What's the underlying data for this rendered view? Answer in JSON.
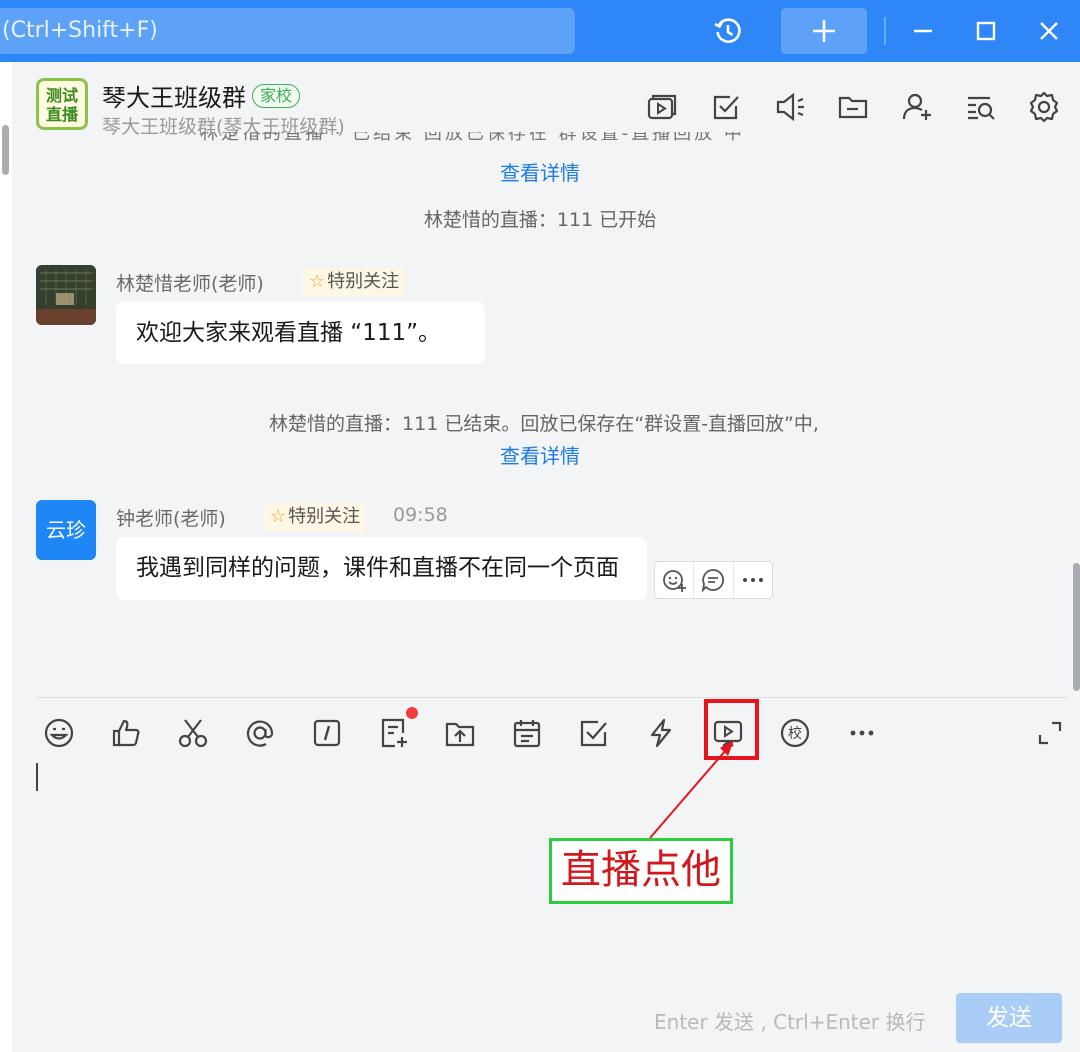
{
  "titlebar": {
    "search_placeholder": "(Ctrl+Shift+F)"
  },
  "chat": {
    "group_avatar_text": "测试直播",
    "group_name": "琴大王班级群",
    "group_tag": "家校",
    "group_subname": "琴大王班级群(琴大王班级群)"
  },
  "messages": {
    "cut_text": "林楚惜的直播  ·  已结束 回放已保存在  群设置-直播回放  中",
    "view_details_1": "查看详情",
    "live_started": "林楚惜的直播：111 已开始",
    "msg1_sender": "林楚惜老师(老师)",
    "follow_label": "特别关注",
    "msg1_text": "欢迎大家来观看直播 “111”。",
    "live_ended": "林楚惜的直播：111 已结束。回放已保存在“群设置-直播回放”中,",
    "view_details_2": "查看详情",
    "msg2_avatar_text": "云珍",
    "msg2_sender": "钟老师(老师)",
    "msg2_time": "09:58",
    "msg2_text": "我遇到同样的问题，课件和直播不在同一个页面"
  },
  "composer": {
    "hint": "Enter 发送 , Ctrl+Enter 换行",
    "send_label": "发送",
    "annotation_text": "直播点他"
  },
  "colors": {
    "titlebar": "#2f86f6",
    "link": "#1d7ce8",
    "highlight_red": "#e8141b",
    "annotation_green": "#2ecc40"
  }
}
